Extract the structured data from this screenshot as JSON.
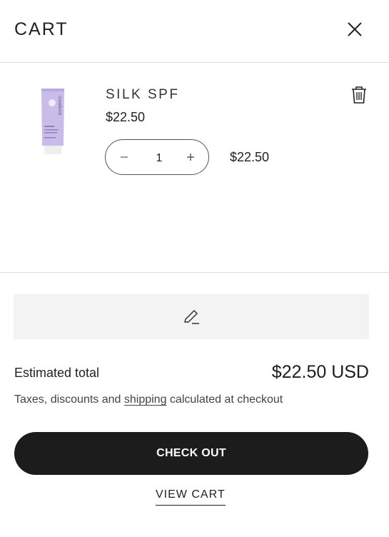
{
  "header": {
    "title": "CART",
    "close_icon": "close-icon"
  },
  "item": {
    "name": "SILK SPF",
    "price": "$22.50",
    "quantity": "1",
    "line_total": "$22.50",
    "product_brand": "crowkind",
    "minus_icon": "minus-icon",
    "plus_icon": "plus-icon",
    "delete_icon": "trash-icon",
    "tube_color": "#c9bce9"
  },
  "note": {
    "icon": "pencil-icon"
  },
  "summary": {
    "estimated_label": "Estimated total",
    "estimated_value": "$22.50 USD",
    "tax_prefix": "Taxes, discounts and ",
    "tax_link": "shipping",
    "tax_suffix": " calculated at checkout"
  },
  "actions": {
    "checkout": "CHECK OUT",
    "view_cart": "VIEW CART"
  },
  "colors": {
    "button_bg": "#1c1c1c",
    "note_bg": "#f3f3f3",
    "divider": "#dcdcdc"
  }
}
